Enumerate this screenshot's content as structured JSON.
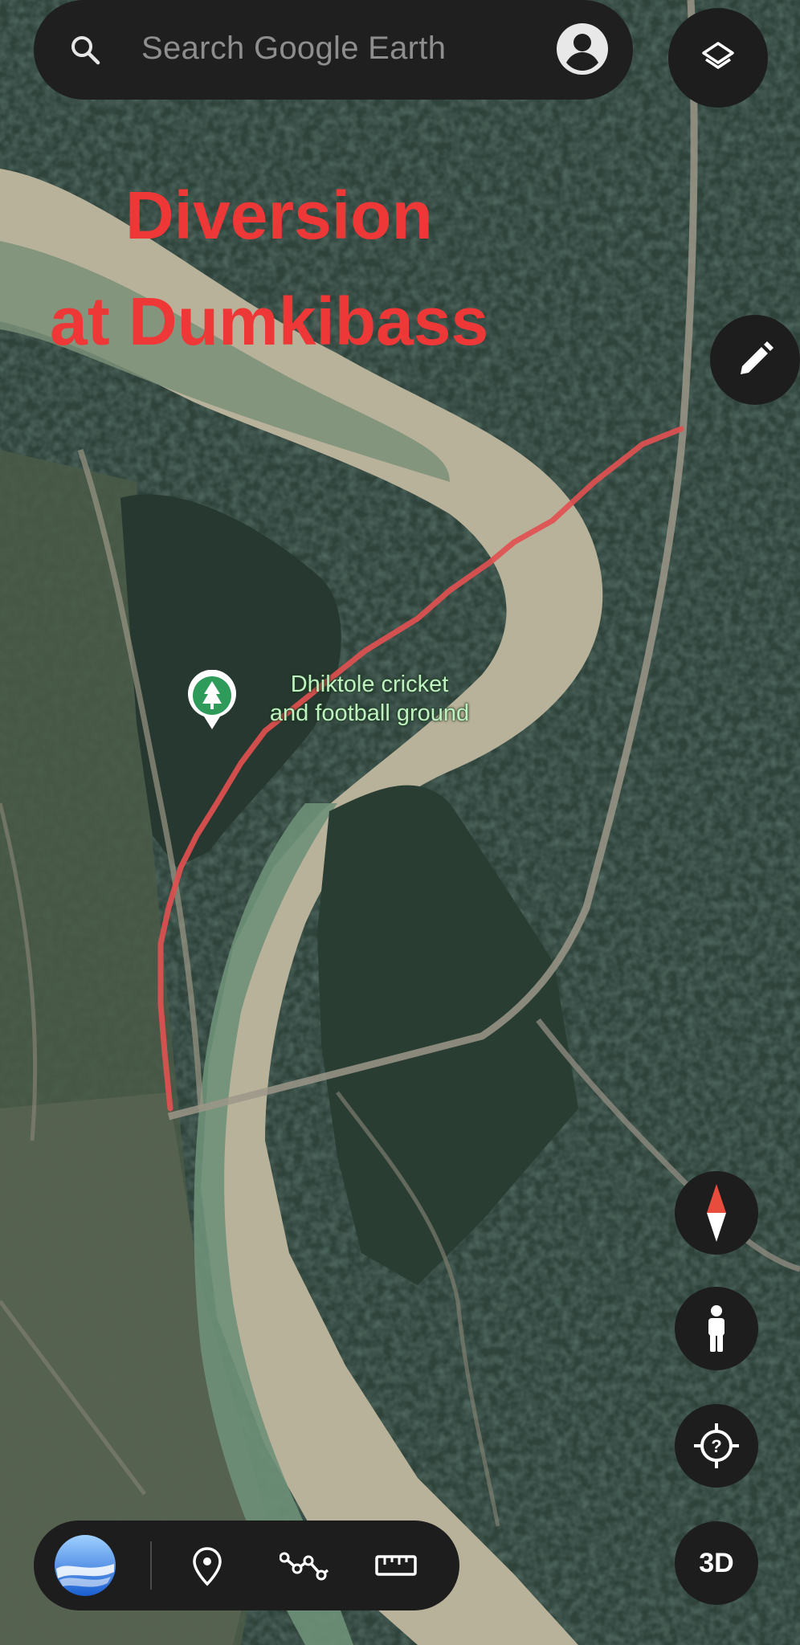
{
  "search": {
    "placeholder": "Search Google Earth"
  },
  "annotation": {
    "line1": "Diversion",
    "line2": "at Dumkibass",
    "color": "#ee3838"
  },
  "place": {
    "line1": "Dhiktole cricket",
    "line2": "and football ground",
    "category_icon": "tree-icon"
  },
  "controls": {
    "layers_icon": "layers-icon",
    "draw_icon": "pencil-icon",
    "compass_icon": "compass-icon",
    "pegman_icon": "pegman-icon",
    "locate_icon": "my-location-icon",
    "view_3d_label": "3D"
  },
  "bottom_bar": {
    "items": [
      "earth-logo-icon",
      "place-pin-icon",
      "draw-path-icon",
      "ruler-icon"
    ]
  },
  "colors": {
    "panel": "#1d1d1d",
    "route": "#e05050",
    "place_pin": "#2e9b5a"
  }
}
